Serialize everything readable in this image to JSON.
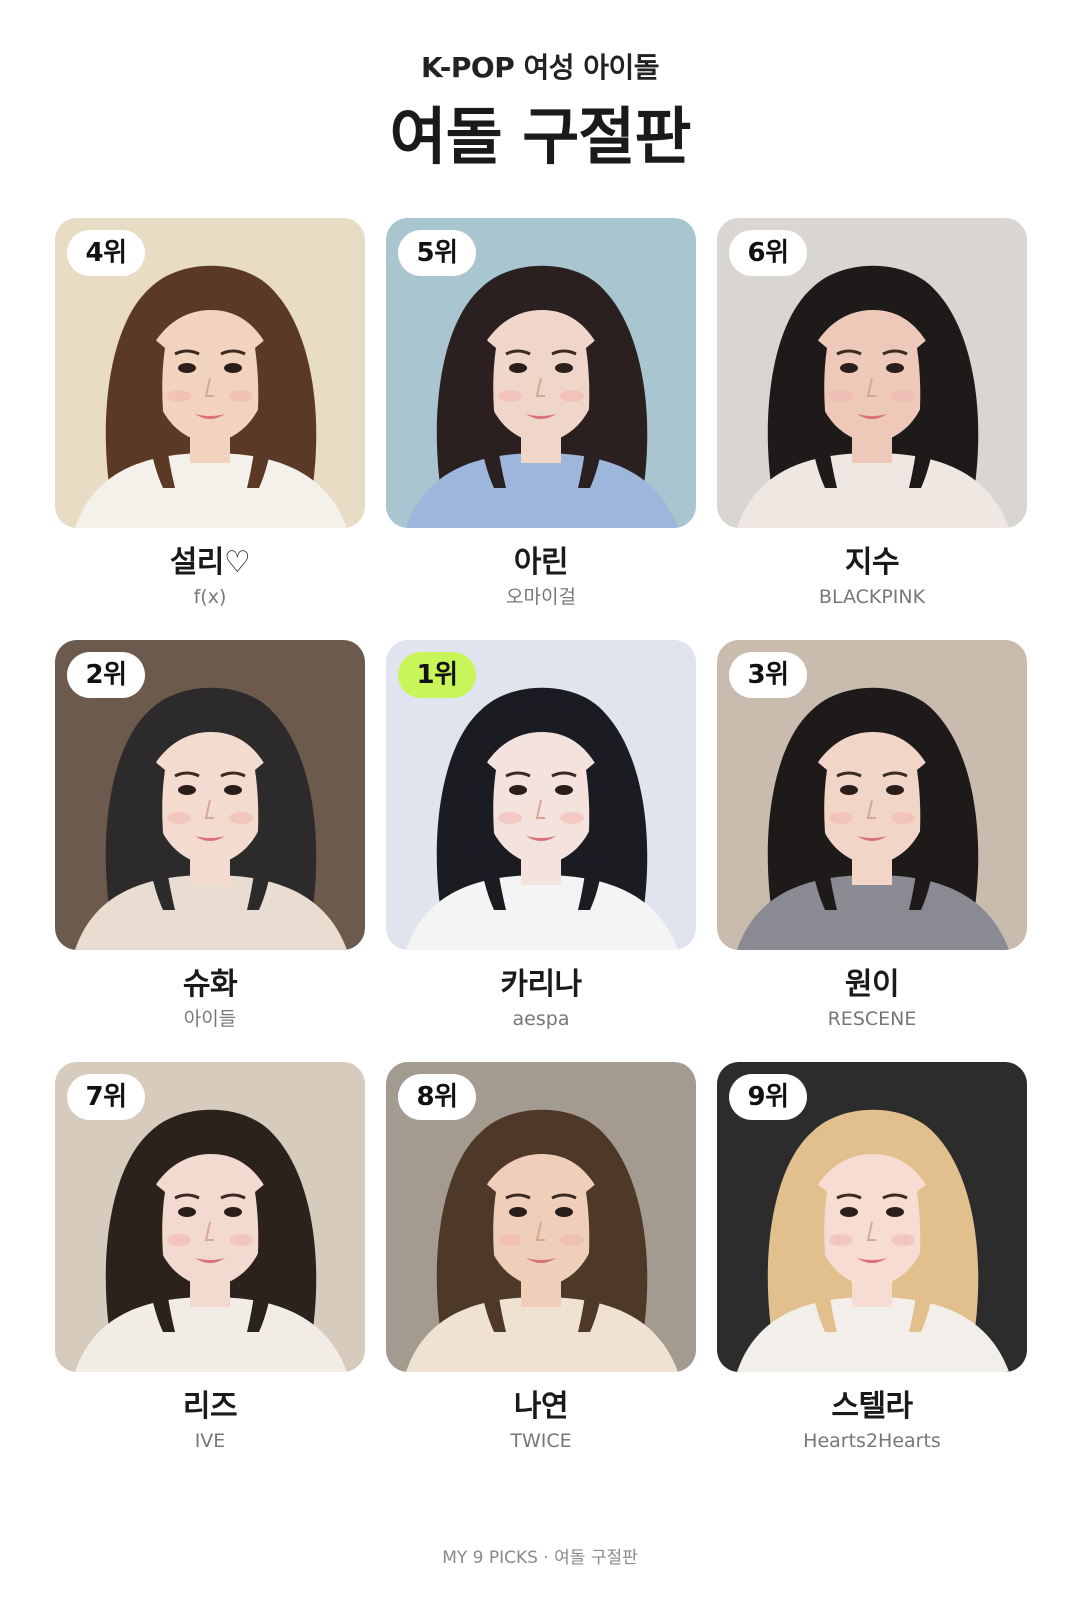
{
  "header": {
    "subtitle": "K-POP 여성 아이돌",
    "title": "여돌 구절판"
  },
  "cards": [
    {
      "rank": "4위",
      "name": "설리♡",
      "group": "f(x)",
      "top": false,
      "bg": "#e8dcc4",
      "hair": "#5a3a26",
      "skin": "#f1d3bf",
      "shirt": "#f4f0ea",
      "portrait": "woman-portrait-icon"
    },
    {
      "rank": "5위",
      "name": "아린",
      "group": "오마이걸",
      "top": false,
      "bg": "#a9c5cf",
      "hair": "#2a2020",
      "skin": "#f0d6c8",
      "shirt": "#9cb6dc",
      "portrait": "woman-portrait-icon"
    },
    {
      "rank": "6위",
      "name": "지수",
      "group": "BLACKPINK",
      "top": false,
      "bg": "#d9d6d2",
      "hair": "#1e1a1a",
      "skin": "#eec8b8",
      "shirt": "#efe8e2",
      "portrait": "woman-portrait-icon"
    },
    {
      "rank": "2위",
      "name": "슈화",
      "group": "아이들",
      "top": false,
      "bg": "#6c5a4c",
      "hair": "#2c2a2a",
      "skin": "#f3dccf",
      "shirt": "#e9dcd0",
      "portrait": "woman-portrait-icon"
    },
    {
      "rank": "1위",
      "name": "카리나",
      "group": "aespa",
      "top": true,
      "bg": "#dfe4ee",
      "hair": "#1b1b22",
      "skin": "#f4e2dc",
      "shirt": "#f4f4f4",
      "portrait": "woman-portrait-icon"
    },
    {
      "rank": "3위",
      "name": "원이",
      "group": "RESCENE",
      "top": false,
      "bg": "#c9bcae",
      "hair": "#1f1a1a",
      "skin": "#f1d6c8",
      "shirt": "#8a8a92",
      "portrait": "woman-portrait-icon"
    },
    {
      "rank": "7위",
      "name": "리즈",
      "group": "IVE",
      "top": false,
      "bg": "#d6cbbd",
      "hair": "#2c221c",
      "skin": "#f3dad0",
      "shirt": "#f2ece6",
      "portrait": "woman-portrait-icon"
    },
    {
      "rank": "8위",
      "name": "나연",
      "group": "TWICE",
      "top": false,
      "bg": "#a39a90",
      "hair": "#4e3828",
      "skin": "#efcfba",
      "shirt": "#efe2d2",
      "portrait": "woman-portrait-icon"
    },
    {
      "rank": "9위",
      "name": "스텔라",
      "group": "Hearts2Hearts",
      "top": false,
      "bg": "#2c2c2c",
      "hair": "#e2c08e",
      "skin": "#f6dcd2",
      "shirt": "#f2eeea",
      "portrait": "woman-portrait-icon"
    }
  ],
  "footer": {
    "text": "MY 9 PICKS · 여돌 구절판"
  },
  "colors": {
    "accent_badge": "#c8f55a",
    "badge": "#ffffff",
    "group_text": "#777777",
    "footer_text": "#8a8a8a"
  }
}
